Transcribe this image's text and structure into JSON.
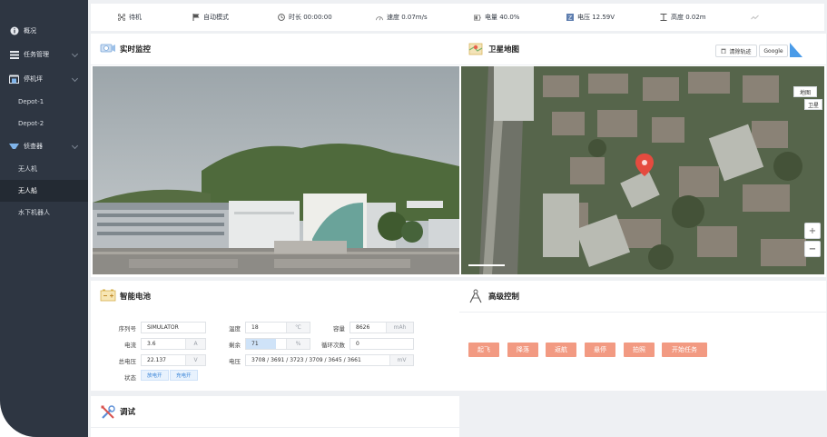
{
  "sidebar": {
    "items": [
      {
        "label": "概况",
        "icon": "info-icon"
      },
      {
        "label": "任务管理",
        "icon": "task-icon"
      },
      {
        "label": "停机坪",
        "icon": "hangar-icon"
      },
      {
        "label": "Depot-1"
      },
      {
        "label": "Depot-2"
      },
      {
        "label": "侦查器",
        "icon": "scout-icon"
      },
      {
        "label": "无人机"
      },
      {
        "label": "无人船"
      },
      {
        "label": "水下机器人"
      }
    ],
    "active_item": "无人船"
  },
  "status_bar": {
    "items": [
      {
        "label": "待机",
        "icon": "drone-icon"
      },
      {
        "label": "自动模式",
        "icon": "flag-icon"
      },
      {
        "label": "时长 00:00:00",
        "icon": "clock-icon"
      },
      {
        "label": "速度 0.07m/s",
        "icon": "speedometer-icon"
      },
      {
        "label": "电量 40.0%",
        "icon": "battery-icon"
      },
      {
        "label": "电压 12.59V",
        "icon": "voltage-icon"
      },
      {
        "label": "高度 0.02m",
        "icon": "altitude-icon"
      }
    ]
  },
  "realtime": {
    "title": "实时监控",
    "icon": "camera-icon"
  },
  "satellite": {
    "title": "卫星地图",
    "icon": "map-icon",
    "clear_track_label": "清除轨迹",
    "google_label": "Google",
    "map_type_label": "地图",
    "satellite_type_label": "卫星",
    "zoom_in_label": "+",
    "zoom_out_label": "−"
  },
  "battery": {
    "title": "智能电池",
    "icon": "battery-panel-icon",
    "serial_label": "序列号",
    "serial_value": "SIMULATOR",
    "current_label": "电流",
    "current_value": "3.6",
    "current_unit": "A",
    "total_voltage_label": "总电压",
    "total_voltage_value": "22.137",
    "total_voltage_unit": "V",
    "status_label": "状态",
    "discharging_label": "放电开",
    "charging_label": "充电开",
    "temperature_label": "温度",
    "temperature_value": "18",
    "temperature_unit": "℃",
    "remaining_label": "剩余",
    "remaining_value": "71",
    "remaining_unit": "%",
    "remaining_percent": 71,
    "cell_voltage_label": "电压",
    "cell_voltage_value": "3708 / 3691 / 3723 / 3709 / 3645 / 3661",
    "cell_voltage_unit": "mV",
    "capacity_label": "容量",
    "capacity_value": "8626",
    "capacity_unit": "mAh",
    "cycles_label": "循环次数",
    "cycles_value": "0"
  },
  "advanced": {
    "title": "高级控制",
    "icon": "compass-icon",
    "buttons": [
      "起飞",
      "降落",
      "返航",
      "悬停",
      "拍照",
      "开始任务"
    ],
    "button_color": "#f29a82"
  },
  "debug": {
    "title": "调试",
    "icon": "tools-icon"
  },
  "colors": {
    "sidebar_bg": "#2e3642",
    "sidebar_active_bg": "#232a33",
    "accent_blue": "#3a85d8",
    "control_button": "#f29a82"
  }
}
